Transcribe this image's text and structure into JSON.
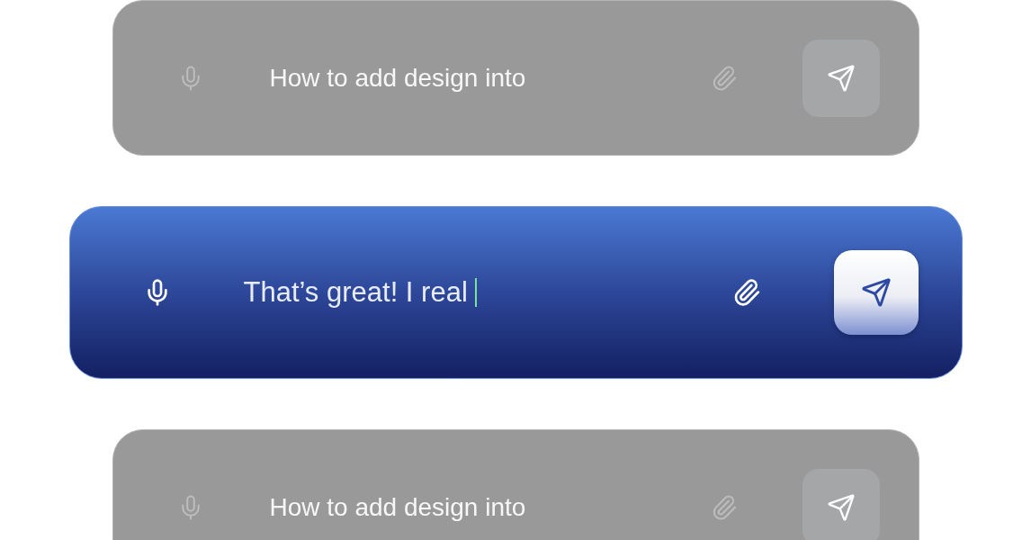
{
  "message_bars": [
    {
      "value": "How to add design into",
      "active": false
    },
    {
      "value": "That’s great! I real",
      "active": true
    },
    {
      "value": "How to add design into",
      "active": false
    }
  ]
}
